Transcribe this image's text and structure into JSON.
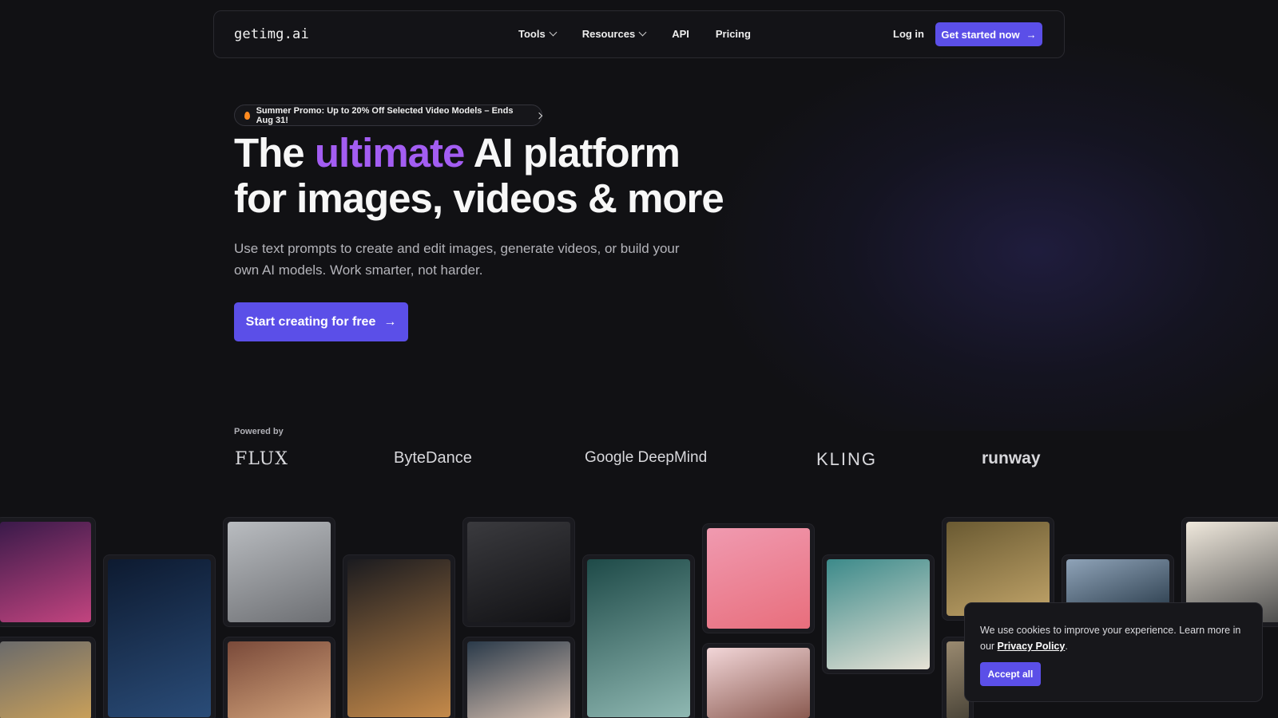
{
  "nav": {
    "logo": "getimg.ai",
    "items": [
      {
        "label": "Tools",
        "has_dropdown": true
      },
      {
        "label": "Resources",
        "has_dropdown": true
      },
      {
        "label": "API",
        "has_dropdown": false
      },
      {
        "label": "Pricing",
        "has_dropdown": false
      }
    ],
    "login_label": "Log in",
    "cta_label": "Get started now",
    "cta_arrow": "→"
  },
  "promo": {
    "text": "Summer Promo: Up to 20% Off Selected Video Models – Ends Aug 31!"
  },
  "hero": {
    "headline_pre": "The ",
    "headline_accent": "ultimate",
    "headline_post": " AI platform",
    "headline_line2": "for images, videos & more",
    "subtitle": "Use text prompts to create and edit images, generate videos, or build your own AI models. Work smarter, not harder.",
    "cta_label": "Start creating for free",
    "cta_arrow": "→"
  },
  "powered": {
    "label": "Powered by",
    "brands": [
      "FLUX",
      "ByteDance",
      "Google DeepMind",
      "KLING",
      "runway"
    ]
  },
  "gallery": {
    "tiles": [
      {
        "name": "glitch-portrait-image",
        "colors": [
          "#3a1a4a",
          "#c2447f"
        ]
      },
      {
        "name": "robot-skeleton-image",
        "colors": [
          "#0d1a30",
          "#2a4c78"
        ]
      },
      {
        "name": "snow-leopard-image",
        "colors": [
          "#b9bcc0",
          "#6d6f73"
        ]
      },
      {
        "name": "corgi-image",
        "colors": [
          "#1b1b1f",
          "#c58a4a"
        ]
      },
      {
        "name": "dark-portrait-image",
        "colors": [
          "#3a3a3e",
          "#111114"
        ]
      },
      {
        "name": "butterfly-woman-image",
        "colors": [
          "#1e4a48",
          "#8fb8b2"
        ]
      },
      {
        "name": "pink-anime-image",
        "colors": [
          "#f09ab0",
          "#e86e7c"
        ]
      },
      {
        "name": "interior-shelves-image",
        "colors": [
          "#3c8a8a",
          "#e6e2d6"
        ]
      },
      {
        "name": "golden-arch-image",
        "colors": [
          "#6a5a32",
          "#c2a56a"
        ]
      },
      {
        "name": "chrome-sphere-image",
        "colors": [
          "#8fa3b8",
          "#324454"
        ]
      },
      {
        "name": "ink-woman-image",
        "colors": [
          "#efe8dc",
          "#4a4a4a"
        ]
      },
      {
        "name": "lowpoly-dog-image",
        "colors": [
          "#6b6b6b",
          "#c9a05a"
        ]
      },
      {
        "name": "monk-image",
        "colors": [
          "#7a4a3a",
          "#d2a27a"
        ]
      },
      {
        "name": "asian-portrait-image",
        "colors": [
          "#2a3a4a",
          "#d8c0b0"
        ]
      },
      {
        "name": "anime-girl-image",
        "colors": [
          "#f2d6d8",
          "#8a5a50"
        ]
      },
      {
        "name": "partial-tile-image",
        "colors": [
          "#9a8a70",
          "#4a4438"
        ]
      }
    ]
  },
  "cookie": {
    "text_pre": "We use cookies to improve your experience. Learn more in our ",
    "link_label": "Privacy Policy",
    "text_post": ".",
    "accept_label": "Accept all"
  }
}
